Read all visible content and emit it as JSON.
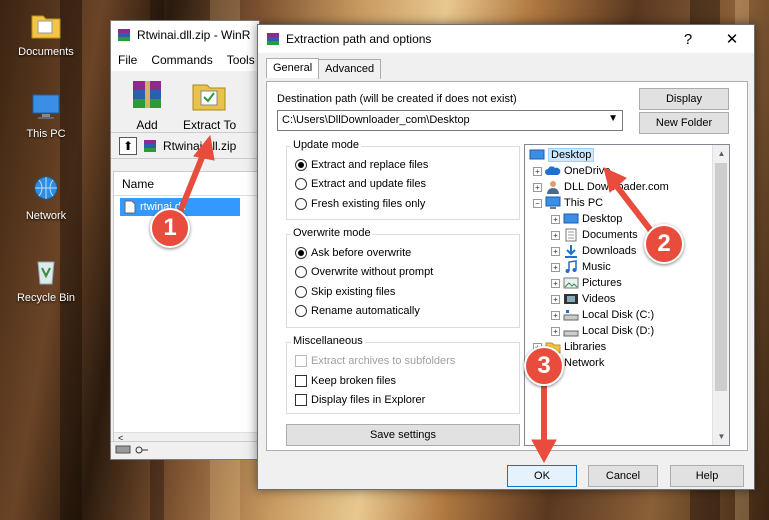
{
  "desktop": {
    "icons": [
      {
        "label": "Documents",
        "icon": "folder-documents-icon"
      },
      {
        "label": "This PC",
        "icon": "computer-icon"
      },
      {
        "label": "Network",
        "icon": "network-icon"
      },
      {
        "label": "Recycle Bin",
        "icon": "recycle-bin-icon"
      }
    ]
  },
  "winrar": {
    "title": "Rtwinai.dll.zip - WinR",
    "menu": [
      "File",
      "Commands",
      "Tools"
    ],
    "toolbar": {
      "add_label": "Add",
      "extract_label": "Extract To"
    },
    "path": "Rtwinai.dll.zip",
    "column_name": "Name",
    "file": "rtwinai.dll"
  },
  "dialog": {
    "title": "Extraction path and options",
    "help_glyph": "?",
    "close_glyph": "✕",
    "tabs": [
      "General",
      "Advanced"
    ],
    "dest_label": "Destination path (will be created if does not exist)",
    "dest_value": "C:\\Users\\DllDownloader_com\\Desktop",
    "display_button": "Display",
    "new_folder_button": "New Folder",
    "update_mode": {
      "title": "Update mode",
      "options": [
        "Extract and replace files",
        "Extract and update files",
        "Fresh existing files only"
      ],
      "selected": 0
    },
    "overwrite_mode": {
      "title": "Overwrite mode",
      "options": [
        "Ask before overwrite",
        "Overwrite without prompt",
        "Skip existing files",
        "Rename automatically"
      ],
      "selected": 0
    },
    "misc": {
      "title": "Miscellaneous",
      "options": [
        "Extract archives to subfolders",
        "Keep broken files",
        "Display files in Explorer"
      ]
    },
    "save_settings": "Save settings",
    "tree": [
      {
        "label": "Desktop",
        "icon": "desktop-icon",
        "selected": true
      },
      {
        "label": "OneDrive",
        "icon": "onedrive-icon"
      },
      {
        "label": "DLL Downloader.com",
        "icon": "user-icon"
      },
      {
        "label": "This PC",
        "icon": "computer-icon"
      },
      {
        "label": "Desktop",
        "icon": "desktop-icon"
      },
      {
        "label": "Documents",
        "icon": "documents-icon"
      },
      {
        "label": "Downloads",
        "icon": "download-icon"
      },
      {
        "label": "Music",
        "icon": "music-icon"
      },
      {
        "label": "Pictures",
        "icon": "pictures-icon"
      },
      {
        "label": "Videos",
        "icon": "videos-icon"
      },
      {
        "label": "Local Disk (C:)",
        "icon": "drive-icon"
      },
      {
        "label": "Local Disk (D:)",
        "icon": "drive-icon"
      },
      {
        "label": "Libraries",
        "icon": "libraries-icon"
      },
      {
        "label": "Network",
        "icon": "network-icon"
      }
    ],
    "ok_button": "OK",
    "cancel_button": "Cancel",
    "help_button": "Help"
  },
  "callouts": [
    "1",
    "2",
    "3"
  ],
  "colors": {
    "callout": "#e74c3c",
    "selection": "#3399ff",
    "accent": "#0078d7"
  }
}
